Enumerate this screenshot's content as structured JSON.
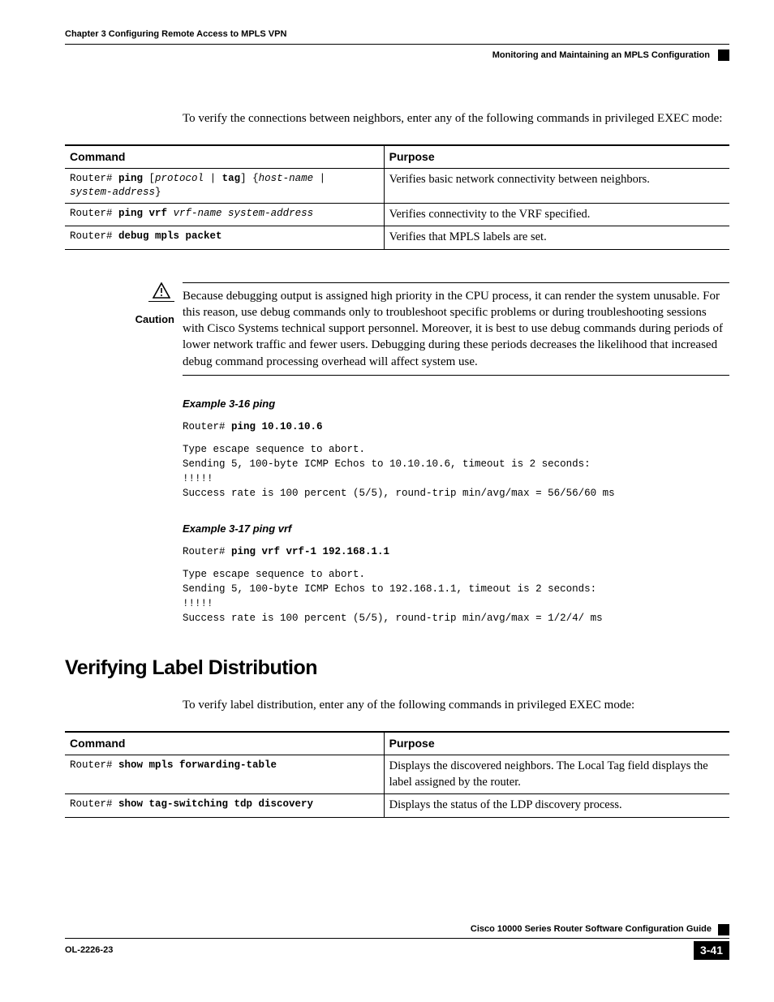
{
  "header": {
    "chapter": "Chapter 3      Configuring Remote Access to MPLS VPN",
    "section": "Monitoring and Maintaining an MPLS Configuration"
  },
  "intro1": "To verify the connections between neighbors, enter any of the following commands in privileged EXEC mode:",
  "table1": {
    "h1": "Command",
    "h2": "Purpose",
    "rows": [
      {
        "prompt": "Router# ",
        "cmd_bold1": "ping",
        "cmd_plain1": " [",
        "cmd_ital1": "protocol",
        "cmd_plain2": " | ",
        "cmd_bold2": "tag",
        "cmd_plain3": "] {",
        "cmd_ital2": "host-name",
        "cmd_plain4": " | ",
        "cmd_ital3": "system-address",
        "cmd_plain5": "}",
        "purpose": "Verifies basic network connectivity between neighbors."
      },
      {
        "prompt": "Router# ",
        "cmd_bold1": "ping vrf",
        "cmd_plain1": " ",
        "cmd_ital1": "vrf-name system-address",
        "purpose": "Verifies connectivity to the VRF specified."
      },
      {
        "prompt": "Router# ",
        "cmd_bold1": "debug mpls packet",
        "purpose": "Verifies that MPLS labels are set."
      }
    ]
  },
  "caution": {
    "label": "Caution",
    "text": "Because debugging output is assigned high priority in the CPU process, it can render the system unusable. For this reason, use debug commands only to troubleshoot specific problems or during troubleshooting sessions with Cisco Systems technical support personnel. Moreover, it is best to use debug commands during periods of lower network traffic and fewer users. Debugging during these periods decreases the likelihood that increased debug command processing overhead will affect system use."
  },
  "ex16": {
    "title": "Example 3-16   ping",
    "prompt": "Router# ",
    "cmd": "ping 10.10.10.6",
    "body": "Type escape sequence to abort.\nSending 5, 100-byte ICMP Echos to 10.10.10.6, timeout is 2 seconds:\n!!!!!\nSuccess rate is 100 percent (5/5), round-trip min/avg/max = 56/56/60 ms"
  },
  "ex17": {
    "title": "Example 3-17   ping vrf",
    "prompt": "Router# ",
    "cmd": "ping vrf vrf-1 192.168.1.1",
    "body": "Type escape sequence to abort.\nSending 5, 100-byte ICMP Echos to 192.168.1.1, timeout is 2 seconds:\n!!!!!\nSuccess rate is 100 percent (5/5), round-trip min/avg/max = 1/2/4/ ms"
  },
  "section2": {
    "title": "Verifying Label Distribution",
    "intro": "To verify label distribution, enter any of the following commands in privileged EXEC mode:"
  },
  "table2": {
    "h1": "Command",
    "h2": "Purpose",
    "rows": [
      {
        "prompt": "Router# ",
        "cmd": "show mpls forwarding-table",
        "purpose": "Displays the discovered neighbors. The Local Tag field displays the label assigned by the router."
      },
      {
        "prompt": "Router# ",
        "cmd": "show tag-switching tdp discovery",
        "purpose": "Displays the status of the LDP discovery process."
      }
    ]
  },
  "footer": {
    "book": "Cisco 10000 Series Router Software Configuration Guide",
    "docnum": "OL-2226-23",
    "pagenum": "3-41"
  }
}
